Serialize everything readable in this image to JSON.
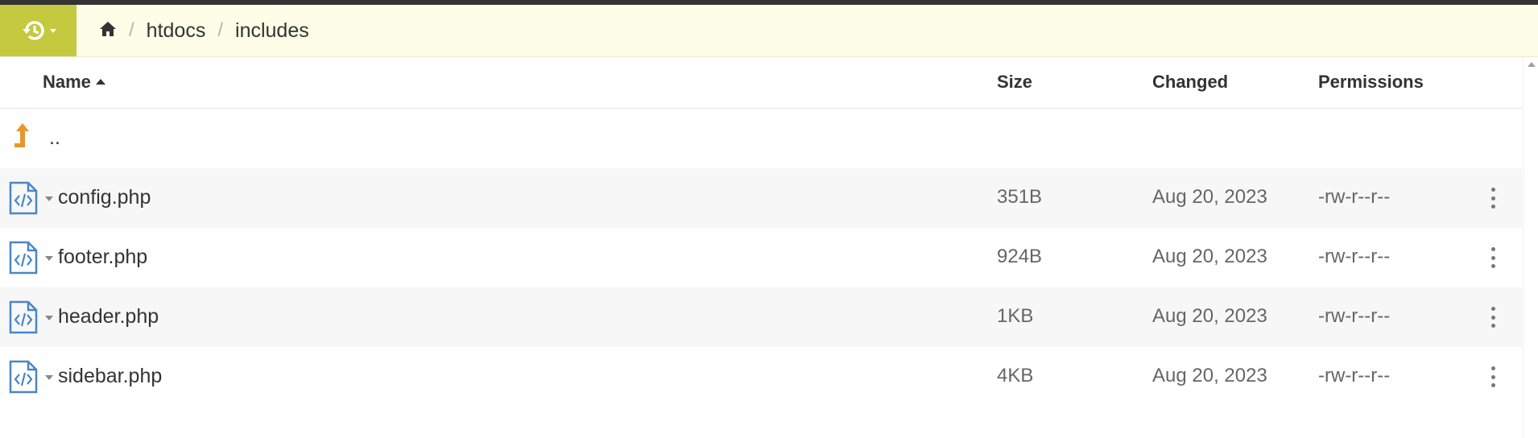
{
  "header": {
    "history_icon": "history-icon",
    "breadcrumb": {
      "home_icon": "home-icon",
      "separator": "/",
      "items": [
        "htdocs",
        "includes"
      ]
    }
  },
  "table": {
    "columns": {
      "name": "Name",
      "size": "Size",
      "changed": "Changed",
      "permissions": "Permissions"
    },
    "sort": {
      "column": "Name",
      "direction": "ascending"
    },
    "parent_row": {
      "label": "..",
      "icon": "parent-folder-icon"
    },
    "rows": [
      {
        "name": "config.php",
        "size": "351B",
        "changed": "Aug 20, 2023",
        "permissions": "-rw-r--r--",
        "icon": "code-file-icon"
      },
      {
        "name": "footer.php",
        "size": "924B",
        "changed": "Aug 20, 2023",
        "permissions": "-rw-r--r--",
        "icon": "code-file-icon"
      },
      {
        "name": "header.php",
        "size": "1KB",
        "changed": "Aug 20, 2023",
        "permissions": "-rw-r--r--",
        "icon": "code-file-icon"
      },
      {
        "name": "sidebar.php",
        "size": "4KB",
        "changed": "Aug 20, 2023",
        "permissions": "-rw-r--r--",
        "icon": "code-file-icon"
      }
    ]
  },
  "colors": {
    "accent": "#c4c93f",
    "header_bg": "#fdfde8",
    "file_icon": "#4a86c5",
    "parent_icon": "#e8962e",
    "alt_row": "#f7f7f7"
  }
}
